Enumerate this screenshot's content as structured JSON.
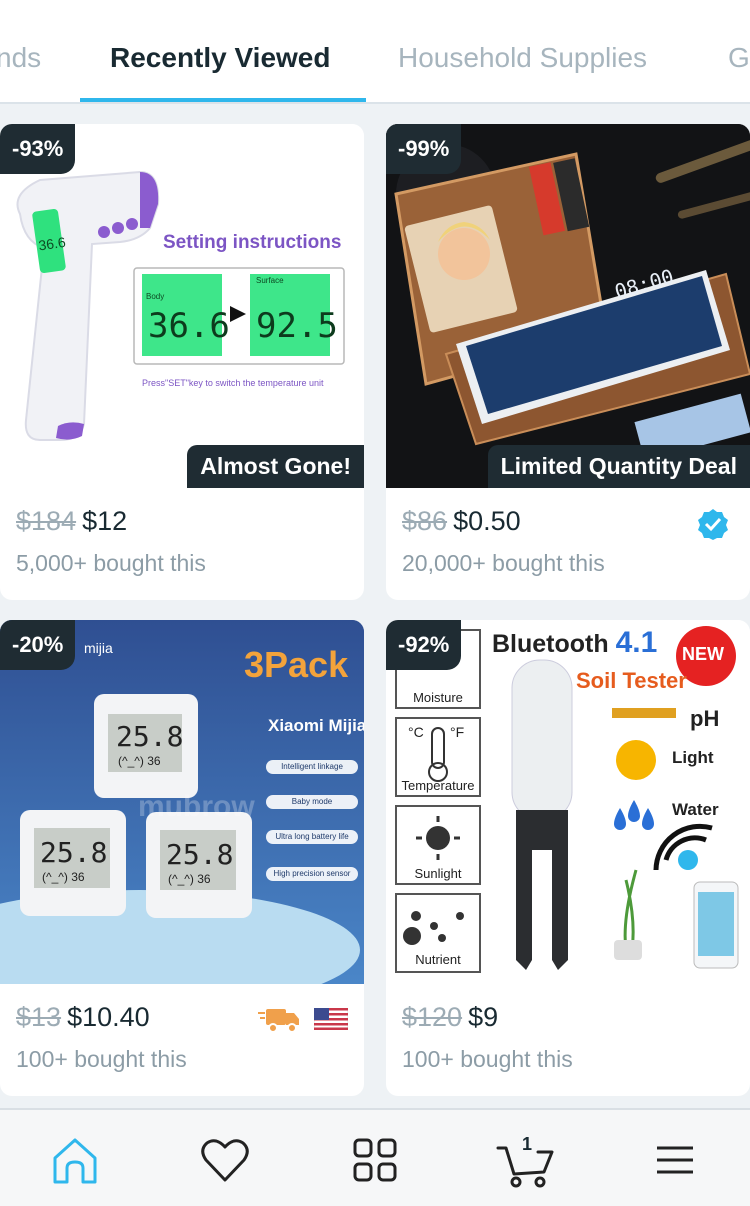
{
  "tabs": [
    {
      "label": "nds"
    },
    {
      "label": "Recently Viewed"
    },
    {
      "label": "Household Supplies"
    },
    {
      "label": "G"
    }
  ],
  "products": [
    {
      "discount": "-93%",
      "tag": "Almost Gone!",
      "old_price": "$184",
      "price": "$12",
      "bought": "5,000+ bought this",
      "image_text": {
        "title": "Setting instructions",
        "body_label": "Body",
        "surface_label": "Surface",
        "body_value": "36.6",
        "surface_value": "92.5",
        "note": "Press\"SET\"key to switch the temperature unit",
        "device_value": "36.6"
      }
    },
    {
      "discount": "-99%",
      "tag": "Limited Quantity Deal",
      "old_price": "$86",
      "price": "$0.50",
      "bought": "20,000+ bought this",
      "image_text": {
        "clock": "08:00"
      }
    },
    {
      "discount": "-20%",
      "old_price": "$13",
      "price": "$10.40",
      "bought": "100+ bought this",
      "image_text": {
        "brand": "mijia",
        "pack": "3Pack",
        "name": "Xiaomi Mijia",
        "features": [
          "Intelligent linkage",
          "Baby mode",
          "Ultra long battery life",
          "High precision sensor"
        ],
        "reading": "25.8",
        "humidity": "(^_^) 36",
        "watermark": "mubrow"
      }
    },
    {
      "discount": "-92%",
      "old_price": "$120",
      "price": "$9",
      "bought": "100+ bought this",
      "image_text": {
        "bt": "Bluetooth",
        "bt_ver": "4.1",
        "new_badge": "NEW",
        "soil": "Soil Tester",
        "ph": "pH",
        "light": "Light",
        "water": "Water",
        "moisture": "Moisture",
        "temperature": "Temperature",
        "sunlight": "Sunlight",
        "nutrient": "Nutrient",
        "celsius": "°C",
        "fahrenheit": "°F"
      }
    }
  ],
  "nav": {
    "cart_count": "1"
  },
  "colors": {
    "accent": "#2fb7ec",
    "badge_bg": "#1f2c33",
    "verified": "#2fb7ec",
    "shipping": "#f0a04b"
  },
  "icons": [
    "home-icon",
    "heart-icon",
    "grid-icon",
    "cart-icon",
    "menu-icon",
    "verified-icon",
    "shipping-truck-icon",
    "us-flag-icon"
  ]
}
